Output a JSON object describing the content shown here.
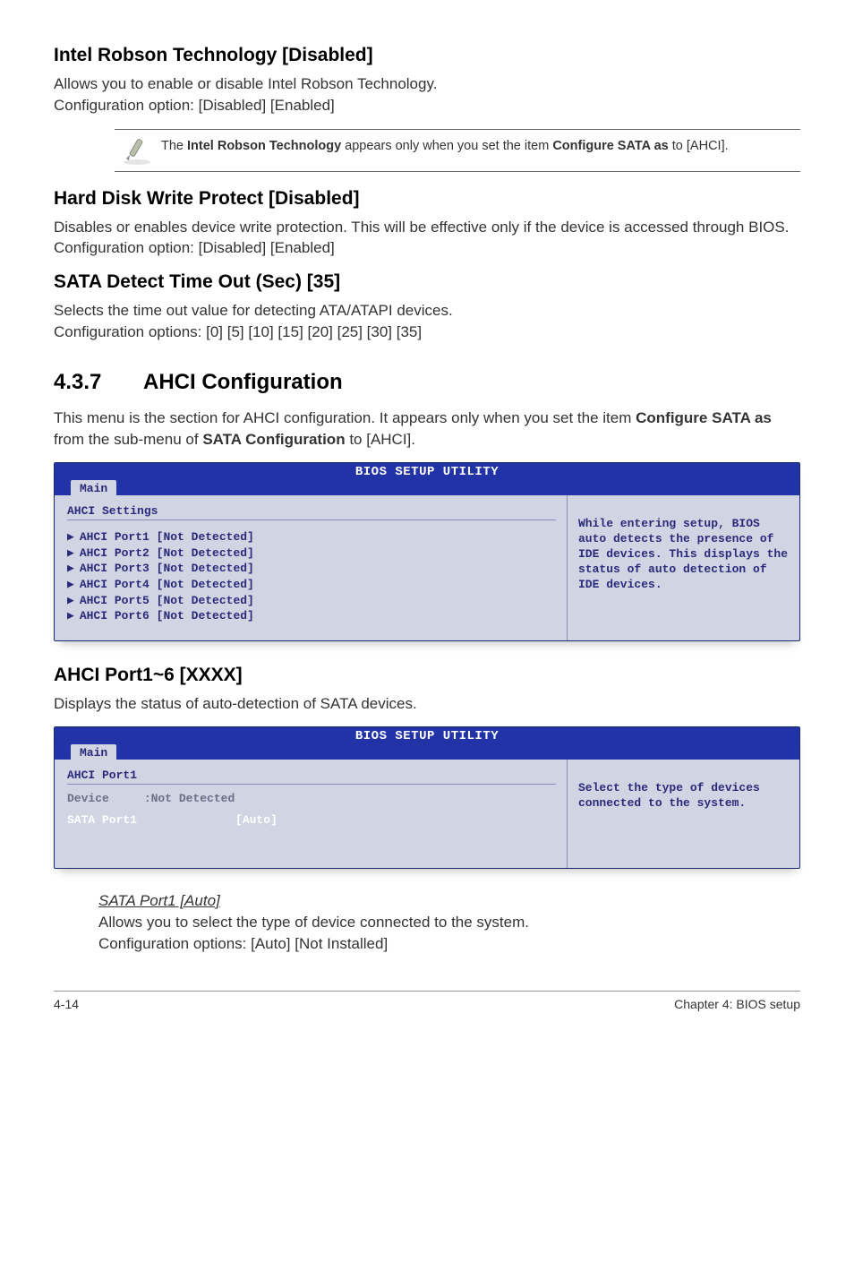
{
  "s1": {
    "heading": "Intel Robson Technology [Disabled]",
    "p1": "Allows you to enable or disable Intel Robson Technology.",
    "p2": "Configuration option: [Disabled] [Enabled]",
    "note_pre": "The ",
    "note_b1": "Intel Robson Technology",
    "note_mid": " appears only when you set the item ",
    "note_b2": "Configure SATA as",
    "note_post": " to [AHCI]."
  },
  "s2": {
    "heading": "Hard Disk Write Protect [Disabled]",
    "p1": "Disables or enables device write protection. This will be effective only if the device is accessed through BIOS. Configuration option: [Disabled] [Enabled]"
  },
  "s3": {
    "heading": "SATA Detect Time Out (Sec) [35]",
    "p1": "Selects the time out value for detecting ATA/ATAPI devices.",
    "p2": "Configuration options: [0] [5] [10] [15] [20] [25] [30] [35]"
  },
  "s4": {
    "num": "4.3.7",
    "title": "AHCI Configuration",
    "p_pre": "This menu is the section for AHCI configuration. It appears only when you set the item ",
    "p_b1": "Configure SATA as",
    "p_mid": " from the sub-menu of ",
    "p_b2": "SATA Configuration",
    "p_post": " to [AHCI]."
  },
  "bios1": {
    "title": "BIOS SETUP UTILITY",
    "tab": "Main",
    "subtitle": "AHCI Settings",
    "items": [
      "AHCI Port1 [Not Detected]",
      "AHCI Port2 [Not Detected]",
      "AHCI Port3 [Not Detected]",
      "AHCI Port4 [Not Detected]",
      "AHCI Port5 [Not Detected]",
      "AHCI Port6 [Not Detected]"
    ],
    "help": "While entering setup, BIOS auto detects the presence of IDE devices. This displays the status of auto detection of IDE devices."
  },
  "s5": {
    "heading": "AHCI Port1~6 [XXXX]",
    "p1": "Displays the status of auto-detection of SATA devices."
  },
  "bios2": {
    "title": "BIOS SETUP UTILITY",
    "tab": "Main",
    "subtitle": "AHCI Port1",
    "dev_label": "Device",
    "dev_value": ":Not Detected",
    "field_label": "SATA Port1",
    "field_value": "[Auto]",
    "help": "Select the type of devices connected to the system."
  },
  "s6": {
    "sub": "SATA Port1 [Auto]",
    "p1": "Allows you to select the type of device connected to the system.",
    "p2": "Configuration options: [Auto] [Not Installed]"
  },
  "footer": {
    "left": "4-14",
    "right": "Chapter 4: BIOS setup"
  }
}
